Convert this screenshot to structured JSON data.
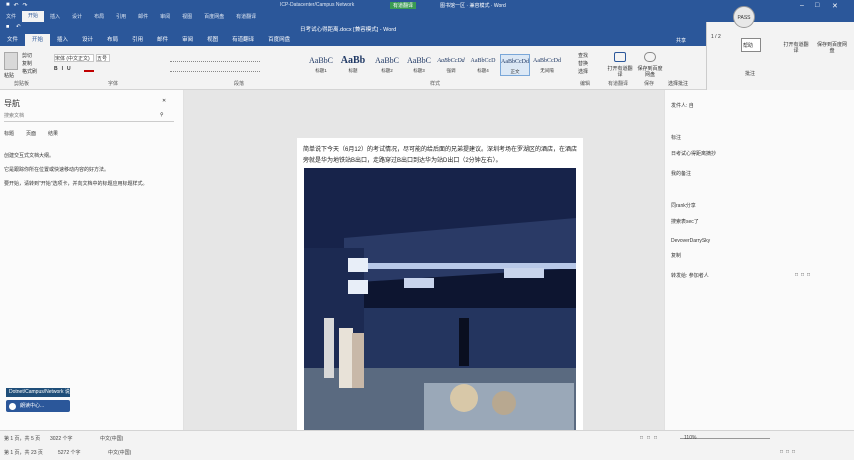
{
  "outer": {
    "title": "ICP-Datacenter/Campus Network",
    "tabs": [
      "文件",
      "开始",
      "插入",
      "设计",
      "布局",
      "引用",
      "邮件",
      "审阅",
      "视图",
      "百度网盘",
      "有道翻译",
      "百度网盘"
    ],
    "share_label": "共享",
    "green_label": "有道翻译",
    "doc_hint": "图书馆一区 · 兼容模式 · Word"
  },
  "title_bar": {
    "title": "日考试心得距离.docx [兼容模式] - Word"
  },
  "tabs": [
    "文件",
    "开始",
    "插入",
    "设计",
    "布局",
    "引用",
    "邮件",
    "审阅",
    "视图",
    "有道翻译",
    "百度网盘"
  ],
  "active_tab_index": 1,
  "ribbon": {
    "clipboard": {
      "label": "剪贴板",
      "paste": "粘贴",
      "cut": "剪切",
      "copy": "复制",
      "format": "格式刷"
    },
    "font": {
      "label": "字体",
      "name": "宋体 (中文正文)",
      "size": "五号"
    },
    "paragraph": {
      "label": "段落"
    },
    "styles": {
      "label": "样式",
      "items": [
        {
          "sample": "AaBbC",
          "name": "标题1"
        },
        {
          "sample": "AaBb",
          "name": "标题"
        },
        {
          "sample": "AaBbC",
          "name": "标题2"
        },
        {
          "sample": "AaBbC",
          "name": "标题3"
        },
        {
          "sample": "AaBbCcDd",
          "name": "强调"
        },
        {
          "sample": "AaBbCcD",
          "name": "标题4"
        },
        {
          "sample": "AaBbCcDd",
          "name": "正文"
        },
        {
          "sample": "AaBbCcDd",
          "name": "无间隔"
        }
      ]
    },
    "editing": {
      "find": "查找",
      "replace": "替换",
      "select": "选择",
      "label": "编辑"
    },
    "youdao": {
      "open": "打开有道翻译",
      "label": "有道翻译"
    },
    "baidu": {
      "save": "保存到百度网盘",
      "label": "保存"
    },
    "help": "帮助",
    "comments_label": "批注"
  },
  "nav": {
    "title": "导航",
    "search_placeholder": "搜索文档",
    "tabs": [
      "标题",
      "页面",
      "结果"
    ],
    "messages": [
      "创建交互式文档大纲。",
      "它是跟踪你所在位置或快速移动内容的好方法。",
      "要开始，请转到\"开始\"选项卡，并向文档中的标题应用标题样式。"
    ],
    "toast": "Dotnet/Campus/Network 说明",
    "voice_label": "朗读中心..."
  },
  "document": {
    "paragraph": "简单说下今天（6月12）的考试情况，尽可能的给后面的兄弟提建议。深圳考场在罗湖区的酒店，在酒店旁就是华为地铁站B出口，走路穿过B出口到达华为站D出口（2分钟左右）。"
  },
  "side_pane": {
    "items": [
      "发件人: 自",
      "标注",
      "日考试心得距离摘抄",
      "我的备注",
      "同rank分享",
      "搜索表sec了",
      "DevoverDarrySky",
      "复制",
      "转发给: 参加者人"
    ],
    "help_title": "选择批注",
    "help_button": "批注"
  },
  "status": {
    "page": "第 1 页，共 5 页",
    "words": "3022 个字",
    "lang": "中文(中国)",
    "zoom": "110%",
    "page2": "第 1 页，共 23 页",
    "words2": "5272 个字",
    "lang2": "中文(中国)"
  },
  "avatar_text": "PASS"
}
